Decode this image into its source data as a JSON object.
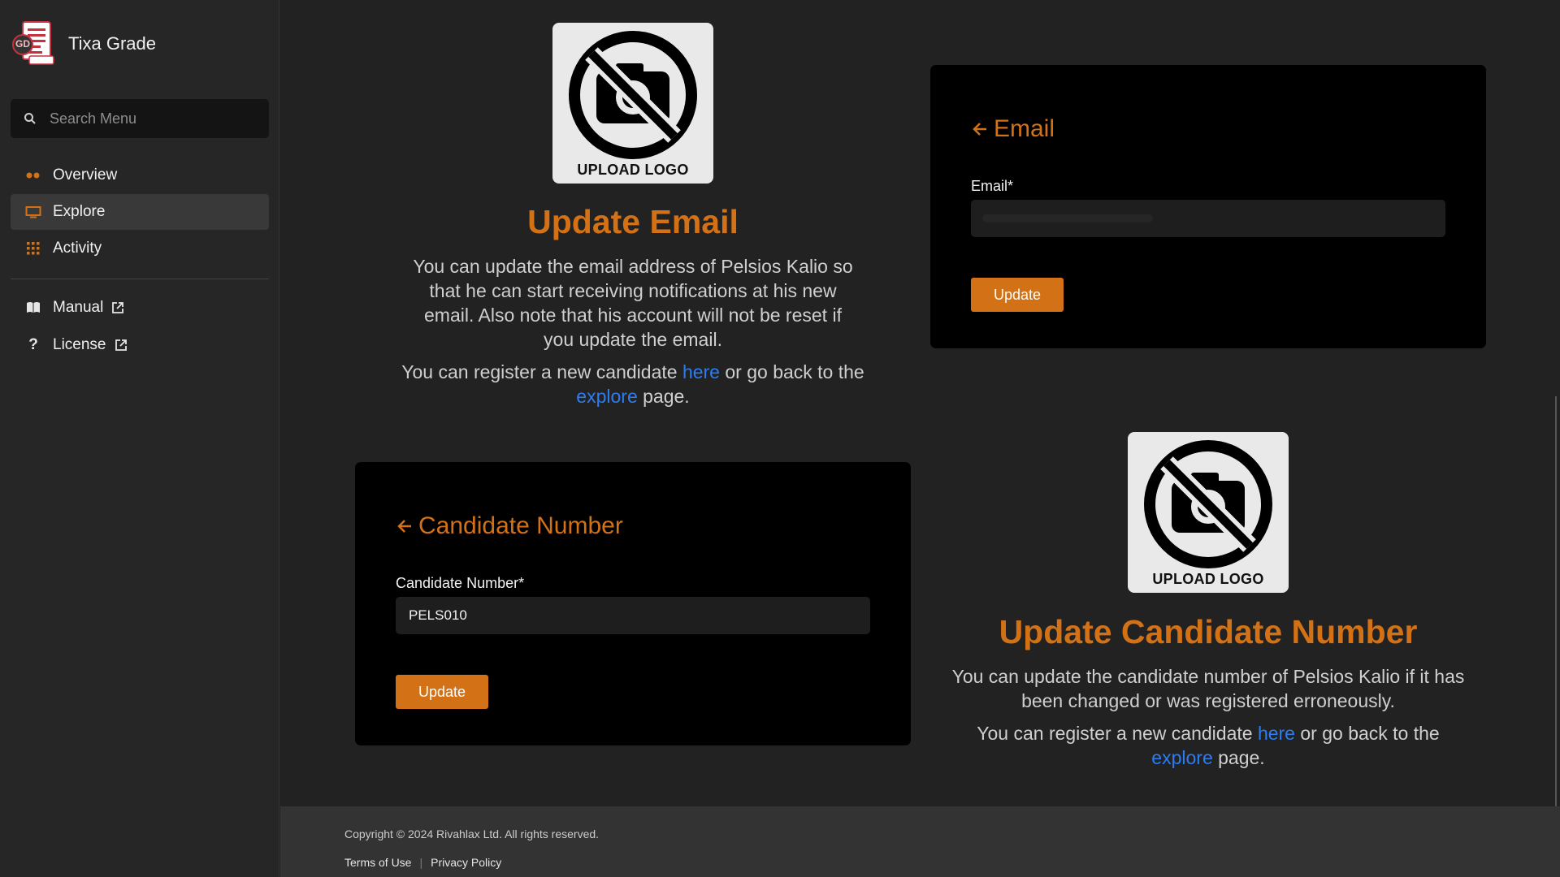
{
  "app": {
    "name": "Tixa Grade",
    "logo_badge": "GD"
  },
  "search": {
    "placeholder": "Search Menu"
  },
  "sidebar": {
    "items": [
      {
        "label": "Overview",
        "icon": "dots-icon",
        "active": false
      },
      {
        "label": "Explore",
        "icon": "monitor-icon",
        "active": true
      },
      {
        "label": "Activity",
        "icon": "grid-icon",
        "active": false
      }
    ],
    "links": [
      {
        "label": "Manual",
        "icon": "book-icon",
        "external": true
      },
      {
        "label": "License",
        "icon": "question-icon",
        "external": true
      }
    ]
  },
  "email_section": {
    "logo_label": "UPLOAD LOGO",
    "heading": "Update Email",
    "description": "You can update the email address of Pelsios Kalio so that he can start receiving notifications at his new email. Also note that his account will not be reset if you update the email.",
    "register_prefix": "You can register a new candidate",
    "here_link": "here",
    "middle": "or go back to the",
    "explore_link": "explore",
    "suffix": "page.",
    "card": {
      "title": "Email",
      "field_label": "Email*",
      "field_value": "",
      "button": "Update"
    }
  },
  "candidate_section": {
    "logo_label": "UPLOAD LOGO",
    "heading": "Update Candidate Number",
    "description": "You can update the candidate number of Pelsios Kalio if it has been changed or was registered erroneously.",
    "register_prefix": "You can register a new candidate",
    "here_link": "here",
    "middle": "or go back to the",
    "explore_link": "explore",
    "suffix": "page.",
    "card": {
      "title": "Candidate Number",
      "field_label": "Candidate Number*",
      "field_value": "PELS010",
      "button": "Update"
    }
  },
  "footer": {
    "copyright": "Copyright © 2024 Rivahlax Ltd. All rights reserved.",
    "terms": "Terms of Use",
    "separator": "|",
    "privacy": "Privacy Policy"
  },
  "colors": {
    "accent": "#d27116",
    "link": "#2d7cf0",
    "background": "#222222",
    "card": "#000000"
  }
}
